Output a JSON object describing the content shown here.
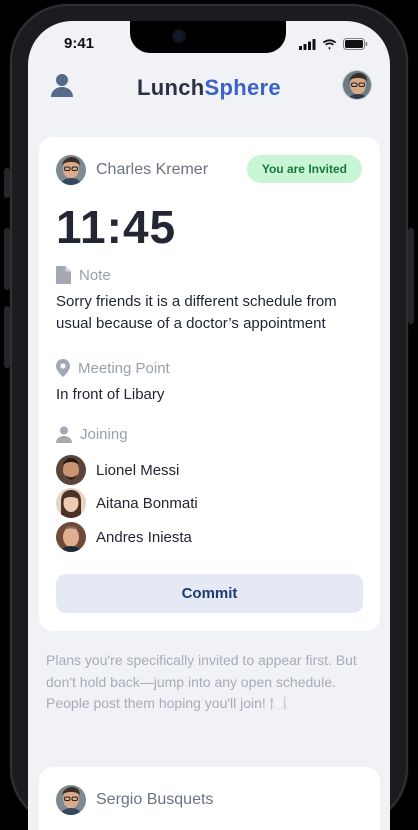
{
  "status_bar": {
    "time": "9:41"
  },
  "header": {
    "brand_part1": "Lunch",
    "brand_part2": "Sphere"
  },
  "plan_card": {
    "host_name": "Charles Kremer",
    "badge": "You are Invited",
    "time": "11:45",
    "note_label": "Note",
    "note_text": "Sorry friends it is a different schedule from usual because of a doctor’s appointment",
    "meeting_label": "Meeting Point",
    "meeting_text": "In front of Libary",
    "joining_label": "Joining",
    "joiners": [
      "Lionel Messi",
      "Aitana Bonmati",
      "Andres Iniesta"
    ],
    "commit_label": "Commit"
  },
  "info_text": "Plans you're specifically invited to appear first. But don't hold back—jump into any open schedule. People post them hoping you'll join! 🍽️",
  "next_card": {
    "host_name": "Sergio Busquets"
  },
  "colors": {
    "brand_accent": "#3a62c9",
    "badge_bg": "#c8f5d4",
    "badge_text": "#187a3a",
    "commit_bg": "#e5e9f3"
  }
}
